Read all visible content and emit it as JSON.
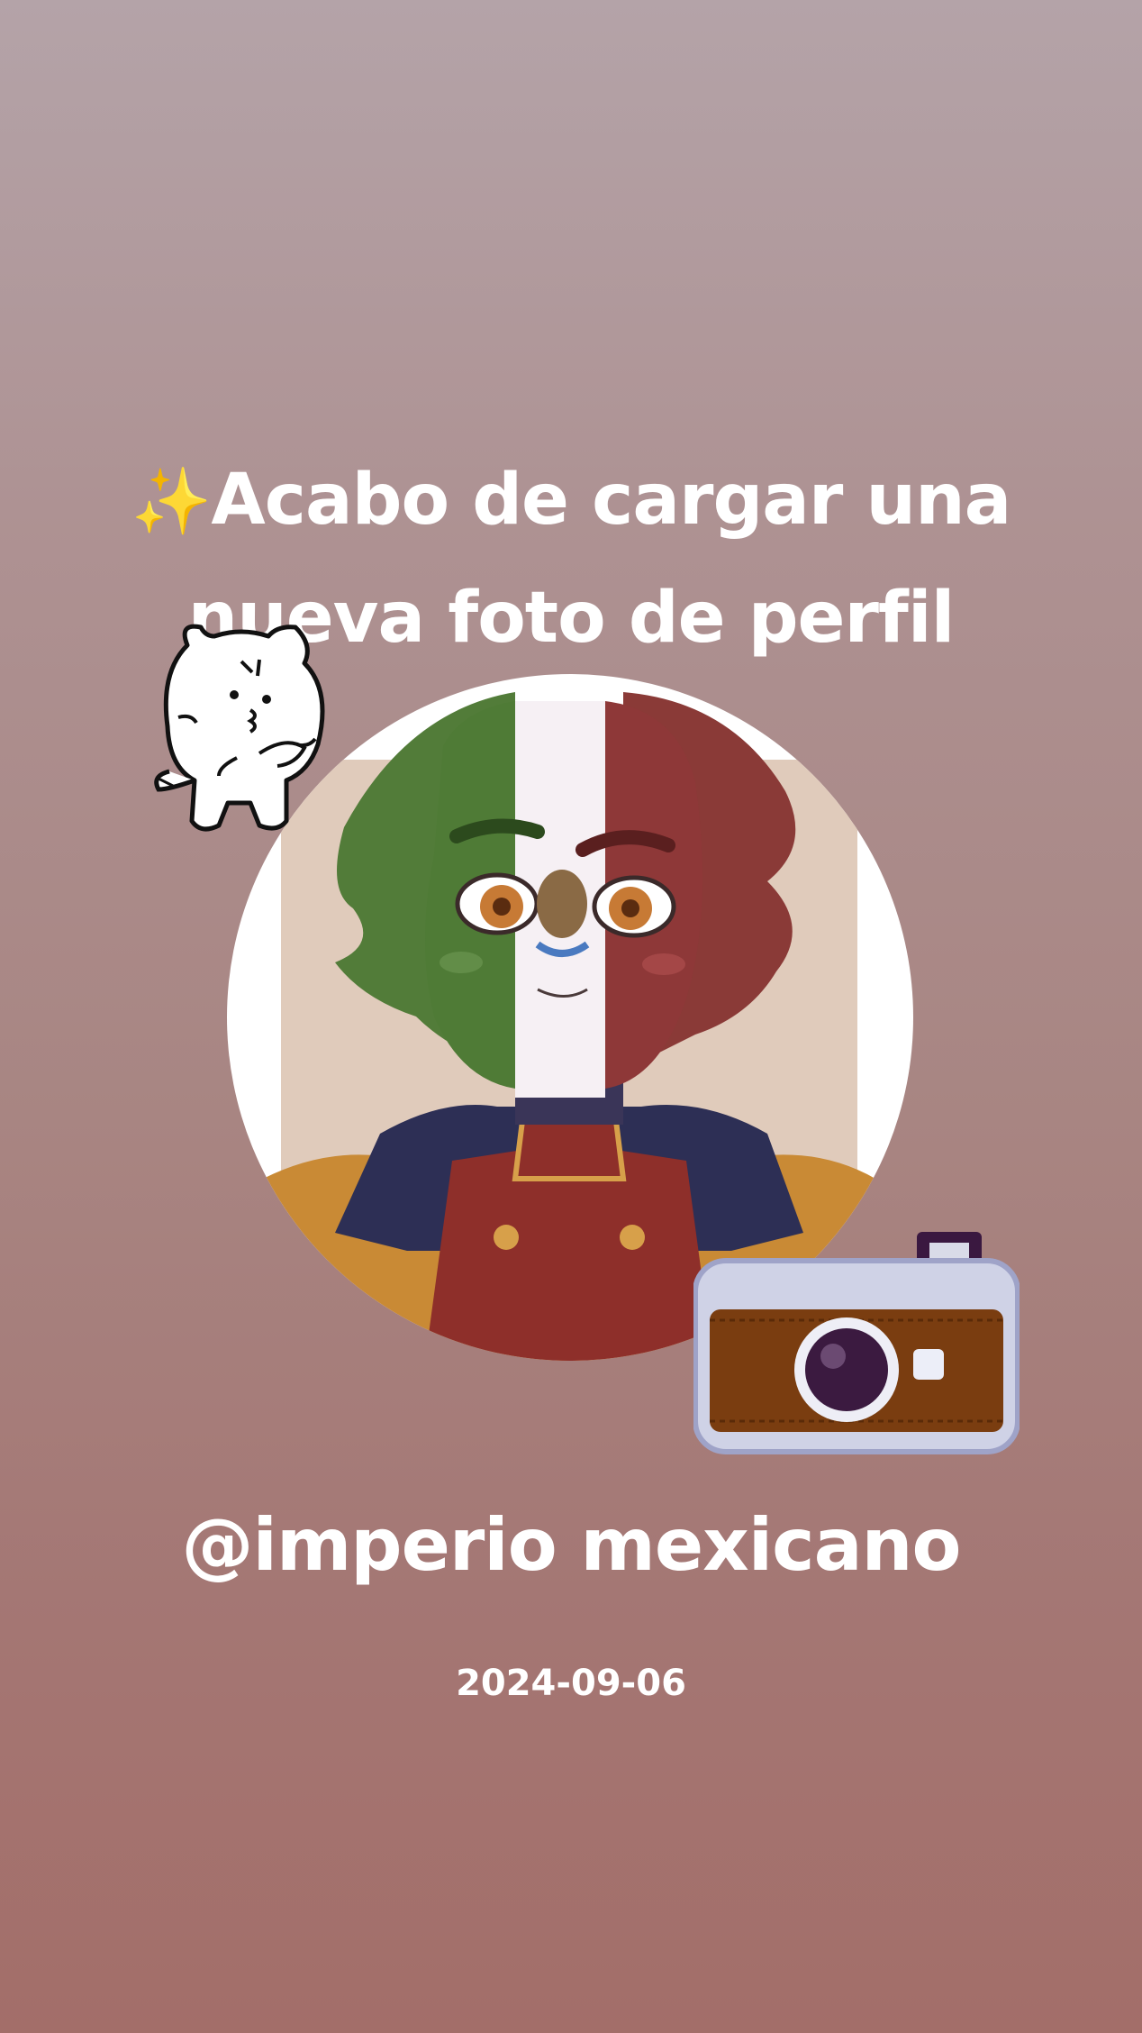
{
  "headline": {
    "sparkle": "✨",
    "line1": "Acabo de cargar una",
    "line2": "nueva foto de perfil"
  },
  "profile": {
    "handle": "@imperio mexicano",
    "date": "2024-09-06"
  },
  "stickers": {
    "top_left": "cat-sticker-icon",
    "bottom_right": "camera-icon"
  },
  "colors": {
    "text": "#ffffff",
    "flag_green": "#4e7c3a",
    "flag_white": "#ffffff",
    "flag_red": "#8e3a3a",
    "camera_body": "#7a3d10"
  }
}
